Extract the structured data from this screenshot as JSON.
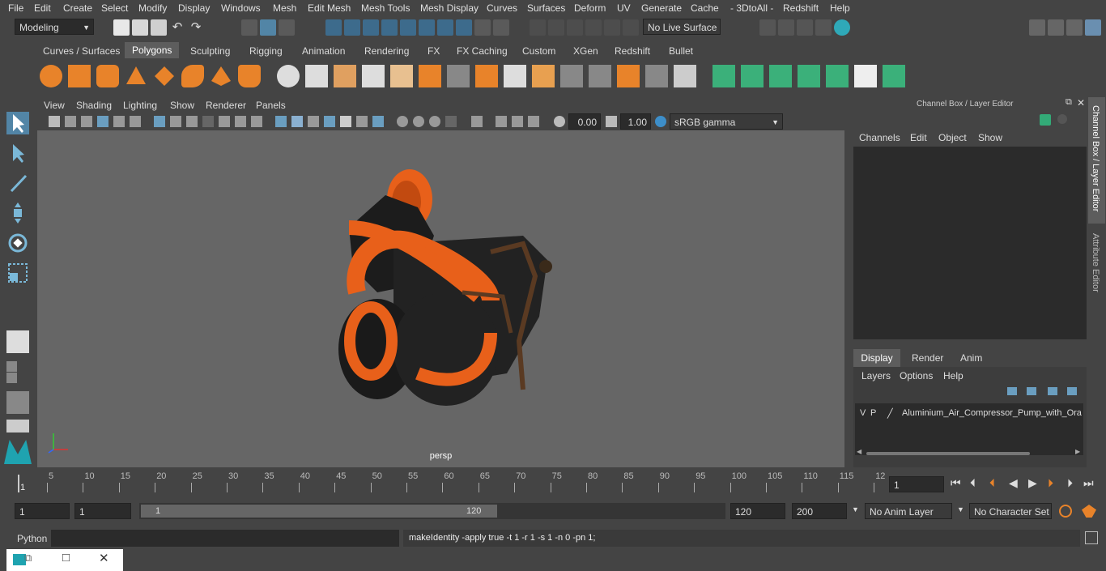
{
  "menu": [
    "File",
    "Edit",
    "Create",
    "Select",
    "Modify",
    "Display",
    "Windows",
    "Mesh",
    "Edit Mesh",
    "Mesh Tools",
    "Mesh Display",
    "Curves",
    "Surfaces",
    "Deform",
    "UV",
    "Generate",
    "Cache",
    "- 3DtoAll -",
    "Redshift",
    "Help"
  ],
  "status": {
    "mode": "Modeling",
    "live_surface": "No Live Surface"
  },
  "shelf_tabs": [
    "Curves / Surfaces",
    "Polygons",
    "Sculpting",
    "Rigging",
    "Animation",
    "Rendering",
    "FX",
    "FX Caching",
    "Custom",
    "XGen",
    "Redshift",
    "Bullet"
  ],
  "shelf_active": "Polygons",
  "panel_menu": [
    "View",
    "Shading",
    "Lighting",
    "Show",
    "Renderer",
    "Panels"
  ],
  "panel_toolbar": {
    "exposure": "0.00",
    "gamma": "1.00",
    "colorspace": "sRGB gamma"
  },
  "viewport": {
    "camera": "persp"
  },
  "channel_box": {
    "title": "Channel Box / Layer Editor",
    "menu": [
      "Channels",
      "Edit",
      "Object",
      "Show"
    ]
  },
  "layer_editor": {
    "tabs": [
      "Display",
      "Render",
      "Anim"
    ],
    "active_tab": "Display",
    "menu": [
      "Layers",
      "Options",
      "Help"
    ],
    "layer_v": "V",
    "layer_p": "P",
    "layer_name": "Aluminium_Air_Compressor_Pump_with_Ora"
  },
  "side_tabs": [
    "Channel Box / Layer Editor",
    "Attribute Editor"
  ],
  "timeline": {
    "ticks": [
      "5",
      "10",
      "15",
      "20",
      "25",
      "30",
      "35",
      "40",
      "45",
      "50",
      "55",
      "60",
      "65",
      "70",
      "75",
      "80",
      "85",
      "90",
      "95",
      "100",
      "105",
      "110",
      "115",
      "12"
    ],
    "start_label": "1",
    "current_frame": "1"
  },
  "range": {
    "start": "1",
    "playback_start": "1",
    "slider_start": "1",
    "slider_end": "120",
    "playback_end": "120",
    "end": "200",
    "anim_layer": "No Anim Layer",
    "char_set": "No Character Set"
  },
  "command": {
    "lang": "Python",
    "output": "makeIdentity -apply true -t 1 -r 1 -s 1 -n 0 -pn 1;"
  },
  "colors": {
    "accent_blue": "#5285a6",
    "orange": "#e8601a",
    "teal": "#2fa9b8"
  }
}
